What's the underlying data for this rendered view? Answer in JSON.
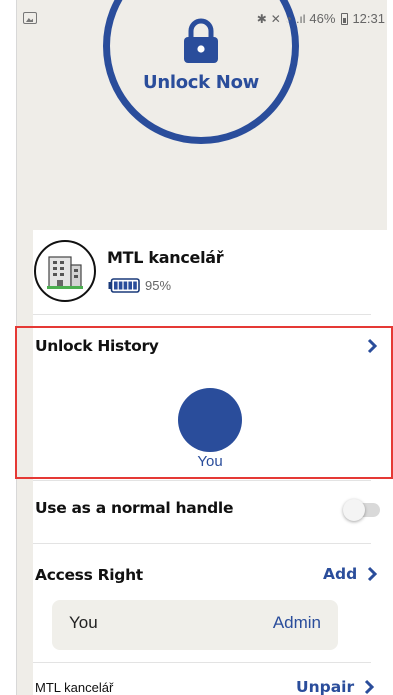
{
  "status_bar": {
    "battery_percent": "46%",
    "time": "12:31"
  },
  "unlock": {
    "label": "Unlock Now"
  },
  "device": {
    "name": "MTL kancelář",
    "battery": "95%",
    "battery_level": 0.95
  },
  "history": {
    "title": "Unlock History",
    "user": "You"
  },
  "normal_handle": {
    "label": "Use as a normal handle",
    "enabled": false
  },
  "access": {
    "title": "Access Right",
    "add_label": "Add",
    "user": "You",
    "role": "Admin"
  },
  "footer": {
    "device_name": "MTL kancelář",
    "unpair_label": "Unpair"
  },
  "colors": {
    "accent": "#2a4d9b",
    "background": "#efede8",
    "card": "#ffffff",
    "highlight": "#e53935"
  }
}
